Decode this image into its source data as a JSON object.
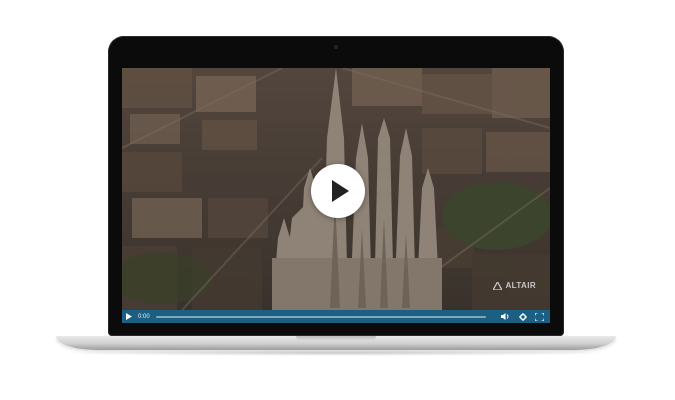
{
  "player": {
    "current_time": "0:00",
    "progress": 0,
    "watermark": "ALTAIR",
    "icons": {
      "play_overlay": "play-icon",
      "play_small": "play-icon",
      "volume": "volume-icon",
      "settings": "gear-icon",
      "fullscreen": "fullscreen-icon",
      "watermark_logo": "triangle-logo-icon"
    },
    "colors": {
      "control_bar": "#1b5f82",
      "overlay_button": "#ffffff",
      "play_glyph": "#222222",
      "laptop_bezel": "#0b0b0b"
    }
  }
}
